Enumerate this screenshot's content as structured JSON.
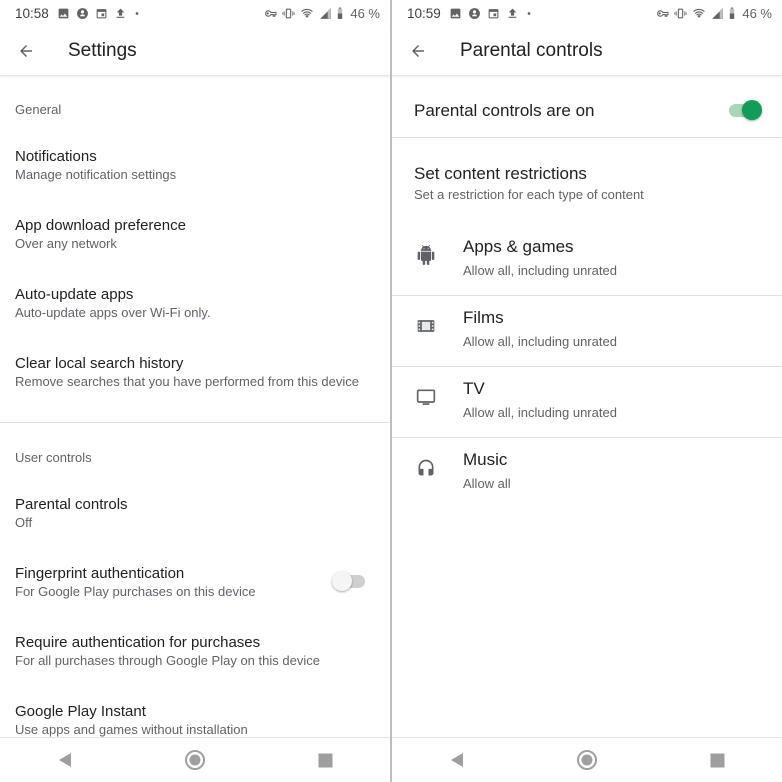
{
  "left": {
    "status": {
      "time": "10:58",
      "battery": "46 %"
    },
    "title": "Settings",
    "sections": [
      {
        "header": "General"
      },
      {
        "header": "User controls"
      }
    ],
    "general_items": [
      {
        "title": "Notifications",
        "subtitle": "Manage notification settings"
      },
      {
        "title": "App download preference",
        "subtitle": "Over any network"
      },
      {
        "title": "Auto-update apps",
        "subtitle": "Auto-update apps over Wi-Fi only."
      },
      {
        "title": "Clear local search history",
        "subtitle": "Remove searches that you have performed from this device"
      }
    ],
    "user_items": [
      {
        "title": "Parental controls",
        "subtitle": "Off"
      },
      {
        "title": "Fingerprint authentication",
        "subtitle": "For Google Play purchases on this device",
        "toggle": "off"
      },
      {
        "title": "Require authentication for purchases",
        "subtitle": "For all purchases through Google Play on this device"
      },
      {
        "title": "Google Play Instant",
        "subtitle": "Use apps and games without installation"
      }
    ]
  },
  "right": {
    "status": {
      "time": "10:59",
      "battery": "46 %"
    },
    "title": "Parental controls",
    "master_toggle": {
      "label": "Parental controls are on",
      "state": "on"
    },
    "restrictions": {
      "title": "Set content restrictions",
      "subtitle": "Set a restriction for each type of content"
    },
    "categories": [
      {
        "icon": "android-icon",
        "title": "Apps & games",
        "subtitle": "Allow all, including unrated"
      },
      {
        "icon": "film-icon",
        "title": "Films",
        "subtitle": "Allow all, including unrated"
      },
      {
        "icon": "tv-icon",
        "title": "TV",
        "subtitle": "Allow all, including unrated"
      },
      {
        "icon": "headphones-icon",
        "title": "Music",
        "subtitle": "Allow all"
      }
    ]
  },
  "colors": {
    "accent": "#0f9d58",
    "accent_track": "#a7d7b7",
    "text_primary": "#202124",
    "text_secondary": "#5f6368"
  }
}
